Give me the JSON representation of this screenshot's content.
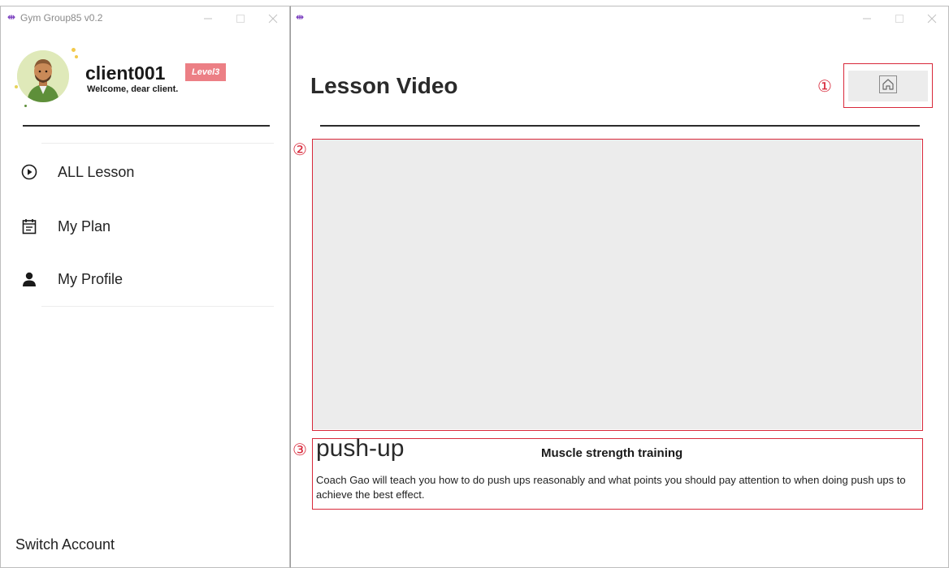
{
  "left_window": {
    "title": "Gym Group85 v0.2",
    "app_icon_glyph": "⇹",
    "controls": {
      "minimize": "—",
      "maximize": "☐",
      "close": "✕"
    }
  },
  "profile": {
    "username": "client001",
    "level": "Level3",
    "welcome": "Welcome, dear client.",
    "avatar_bg": "#dfe9b9"
  },
  "nav": {
    "items": [
      {
        "label": "ALL Lesson",
        "icon": "play-circle-icon"
      },
      {
        "label": "My Plan",
        "icon": "calendar-icon"
      },
      {
        "label": "My Profile",
        "icon": "user-icon"
      }
    ]
  },
  "footer": {
    "switch_account": "Switch Account"
  },
  "right_window": {
    "app_icon_glyph": "⇹",
    "page_title": "Lesson Video",
    "home_icon": "home-icon"
  },
  "annotations": {
    "marker_1": "①",
    "marker_2": "②",
    "marker_3": "③",
    "color": "#d8283a"
  },
  "lesson": {
    "name": "push-up",
    "category": "Muscle strength training",
    "description": "Coach Gao will teach you how to do push ups reasonably and what points you should pay attention to when doing push ups to achieve the best effect."
  },
  "colors": {
    "accent_purple": "#7b3fbf",
    "level_badge": "#ec7f85",
    "panel_gray": "#ececec"
  }
}
